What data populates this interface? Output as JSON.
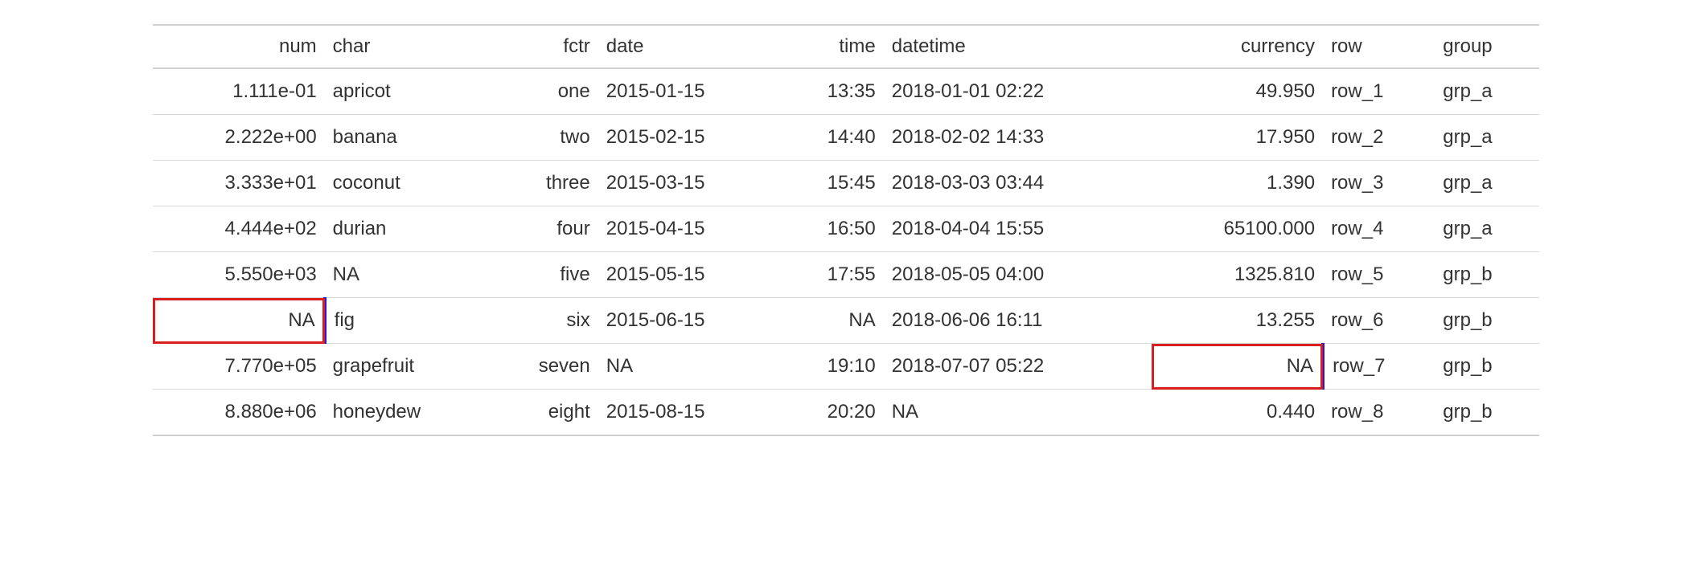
{
  "table": {
    "headers": {
      "num": "num",
      "char": "char",
      "fctr": "fctr",
      "date": "date",
      "time": "time",
      "datetime": "datetime",
      "currency": "currency",
      "row": "row",
      "group": "group"
    },
    "rows": [
      {
        "num": "1.111e-01",
        "char": "apricot",
        "fctr": "one",
        "date": "2015-01-15",
        "time": "13:35",
        "datetime": "2018-01-01 02:22",
        "currency": "49.950",
        "row": "row_1",
        "group": "grp_a",
        "highlight_num": false,
        "highlight_currency": false
      },
      {
        "num": "2.222e+00",
        "char": "banana",
        "fctr": "two",
        "date": "2015-02-15",
        "time": "14:40",
        "datetime": "2018-02-02 14:33",
        "currency": "17.950",
        "row": "row_2",
        "group": "grp_a",
        "highlight_num": false,
        "highlight_currency": false
      },
      {
        "num": "3.333e+01",
        "char": "coconut",
        "fctr": "three",
        "date": "2015-03-15",
        "time": "15:45",
        "datetime": "2018-03-03 03:44",
        "currency": "1.390",
        "row": "row_3",
        "group": "grp_a",
        "highlight_num": false,
        "highlight_currency": false
      },
      {
        "num": "4.444e+02",
        "char": "durian",
        "fctr": "four",
        "date": "2015-04-15",
        "time": "16:50",
        "datetime": "2018-04-04 15:55",
        "currency": "65100.000",
        "row": "row_4",
        "group": "grp_a",
        "highlight_num": false,
        "highlight_currency": false
      },
      {
        "num": "5.550e+03",
        "char": "NA",
        "fctr": "five",
        "date": "2015-05-15",
        "time": "17:55",
        "datetime": "2018-05-05 04:00",
        "currency": "1325.810",
        "row": "row_5",
        "group": "grp_b",
        "highlight_num": false,
        "highlight_currency": false
      },
      {
        "num": "NA",
        "char": "fig",
        "fctr": "six",
        "date": "2015-06-15",
        "time": "NA",
        "datetime": "2018-06-06 16:11",
        "currency": "13.255",
        "row": "row_6",
        "group": "grp_b",
        "highlight_num": true,
        "highlight_currency": false
      },
      {
        "num": "7.770e+05",
        "char": "grapefruit",
        "fctr": "seven",
        "date": "NA",
        "time": "19:10",
        "datetime": "2018-07-07 05:22",
        "currency": "NA",
        "row": "row_7",
        "group": "grp_b",
        "highlight_num": false,
        "highlight_currency": true
      },
      {
        "num": "8.880e+06",
        "char": "honeydew",
        "fctr": "eight",
        "date": "2015-08-15",
        "time": "20:20",
        "datetime": "NA",
        "currency": "0.440",
        "row": "row_8",
        "group": "grp_b",
        "highlight_num": false,
        "highlight_currency": false
      }
    ]
  }
}
